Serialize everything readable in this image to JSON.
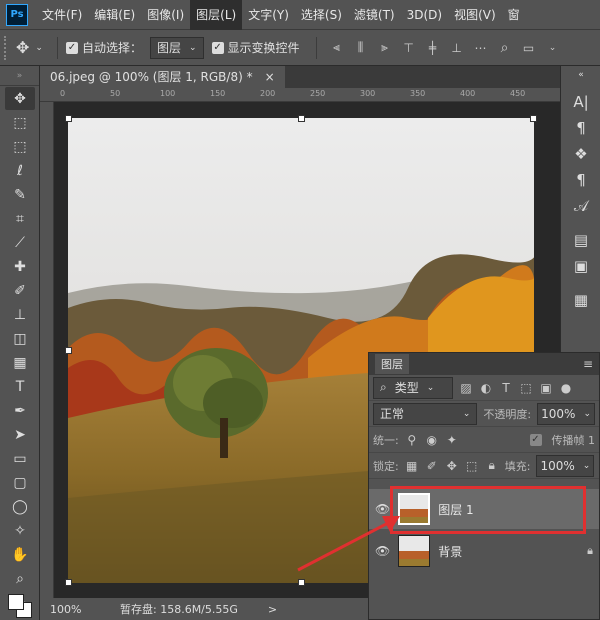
{
  "app": {
    "logo": "Ps"
  },
  "menu": [
    "文件(F)",
    "编辑(E)",
    "图像(I)",
    "图层(L)",
    "文字(Y)",
    "选择(S)",
    "滤镜(T)",
    "3D(D)",
    "视图(V)",
    "窗"
  ],
  "options": {
    "auto_select_label": "自动选择：",
    "auto_select_value": "图层",
    "show_transform_label": "显示变换控件"
  },
  "document": {
    "tab_title": "06.jpeg @ 100% (图层 1, RGB/8) *",
    "close": "×"
  },
  "status": {
    "zoom": "100%",
    "scratch": "暂存盘: 158.6M/5.55G",
    "arrow": ">"
  },
  "layers_panel": {
    "tab": "图层",
    "filter_kind": "类型",
    "blend_mode": "正常",
    "opacity_label": "不透明度:",
    "opacity_value": "100%",
    "unify_label": "统一:",
    "propagate_label": "传播帧 1",
    "lock_label": "锁定:",
    "fill_label": "填充:",
    "fill_value": "100%",
    "layers": [
      {
        "name": "图层 1",
        "selected": true
      },
      {
        "name": "背景",
        "selected": false,
        "locked": true
      }
    ]
  },
  "colors": {
    "accent": "#e03030",
    "panel": "#535353",
    "selected_layer": "#6a6a6a"
  }
}
